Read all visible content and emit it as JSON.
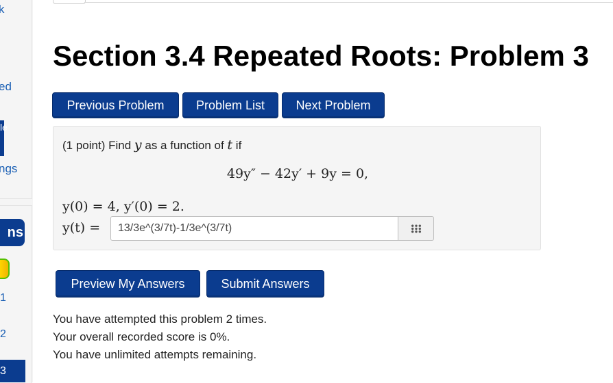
{
  "sidebar": {
    "cut_texts": [
      "k",
      "ed",
      "le",
      "ngs"
    ],
    "heading": "ns",
    "numbers": [
      "1",
      "2"
    ],
    "active_number": "3"
  },
  "page_title": "Section 3.4 Repeated Roots: Problem 3",
  "nav": {
    "previous": "Previous Problem",
    "list": "Problem List",
    "next": "Next Problem"
  },
  "problem": {
    "points": "(1 point) Find",
    "var_y": "y",
    "as_function_of": "as a function of",
    "var_t": "t",
    "if_word": "if",
    "equation": "49y″ − 42y′ + 9y = 0,",
    "initial_conditions": "y(0) = 4,   y′(0) = 2.",
    "answer_label": "y(t) =",
    "answer_value": "13/3e^(3/7t)-1/3e^(3/7t)",
    "palette_icon": "grid-icon"
  },
  "actions": {
    "preview": "Preview My Answers",
    "submit": "Submit Answers"
  },
  "status": {
    "attempts": "You have attempted this problem 2 times.",
    "score": "Your overall recorded score is 0%.",
    "remaining": "You have unlimited attempts remaining."
  },
  "colors": {
    "button_bg": "#0b3c8f",
    "panel_bg": "#f5f5f5",
    "link": "#1a5fb4"
  }
}
